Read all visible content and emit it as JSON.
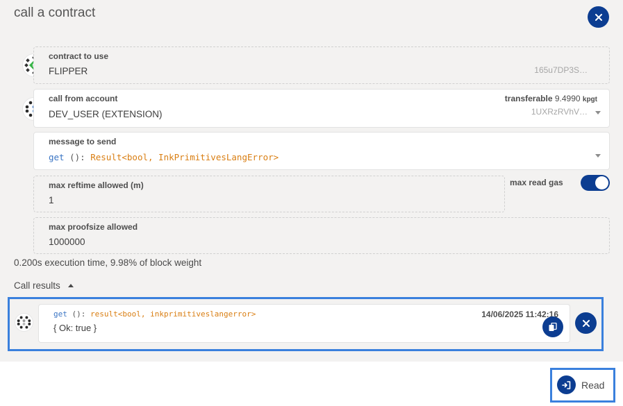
{
  "modal": {
    "title": "call a contract"
  },
  "contract": {
    "label": "contract to use",
    "name": "FLIPPER",
    "address": "165u7DP3S…"
  },
  "account": {
    "label": "call from account",
    "name": "DEV_USER (EXTENSION)",
    "transferable_label": "transferable",
    "balance": "9.4990",
    "unit": "kpgt",
    "address": "1UXRzRVhV…"
  },
  "message": {
    "label": "message to send",
    "method": "get",
    "signature": " (): ",
    "return_type": "Result<bool, InkPrimitivesLangError>"
  },
  "reftime": {
    "label": "max reftime allowed (m)",
    "value": "1"
  },
  "read_gas": {
    "label": "max read gas",
    "enabled": true
  },
  "proofsize": {
    "label": "max proofsize allowed",
    "value": "1000000"
  },
  "execution_info": "0.200s execution time, 9.98% of block weight",
  "results": {
    "header": "Call results",
    "items": [
      {
        "method": "get",
        "signature": " (): ",
        "return_type": "result<bool, inkprimitiveslangerror>",
        "timestamp": "14/06/2025 11:42:16",
        "output": "{ Ok: true }"
      }
    ]
  },
  "footer": {
    "read_label": "Read"
  },
  "colors": {
    "accent": "#0c3d91",
    "highlight": "#3a80dd",
    "method_color": "#3b75c4",
    "type_color": "#d97e12"
  }
}
